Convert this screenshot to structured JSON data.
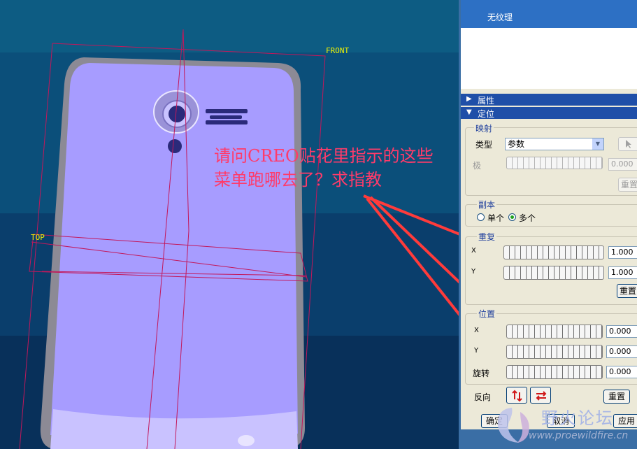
{
  "viewport": {
    "plane_front": "FRONT",
    "plane_top": "TOP",
    "question_line1": "请问CREO贴花里指示的这些",
    "question_line2": "菜单跑哪去了？求指教"
  },
  "panel": {
    "list": {
      "selected_item": "无纹理"
    },
    "sections": {
      "properties": "属性",
      "placement": "定位"
    },
    "mapping": {
      "title": "映射",
      "type_label": "类型",
      "type_value": "参数",
      "pole_label": "极",
      "pole_value": "0.000",
      "reset_label": "重置"
    },
    "copy": {
      "title": "副本",
      "single_label": "单个",
      "multiple_label": "多个",
      "selected": "多个"
    },
    "repeat": {
      "title": "重复",
      "x_label": "X",
      "x_value": "1.000",
      "y_label": "Y",
      "y_value": "1.000",
      "reset_label": "重置"
    },
    "position": {
      "title": "位置",
      "x_label": "X",
      "x_value": "0.000",
      "y_label": "Y",
      "y_value": "0.000",
      "rotate_label": "旋转",
      "rotate_value": "0.000",
      "flip_label": "反向",
      "reset_label": "重置"
    },
    "footer": {
      "ok_label": "确定",
      "cancel_label": "取消",
      "apply_label": "应用"
    }
  },
  "watermark": {
    "title": "野火论坛",
    "url": "www.proewildfire.cn"
  },
  "colors": {
    "phone_face": "#a79cff",
    "arrow": "#ff3b3b",
    "panel_header": "#1f4fa8",
    "list_selection": "#2d70c4",
    "datum_plane": "#c2185b"
  },
  "icons": [
    "dropdown-arrow-icon",
    "cursor-select-icon",
    "flip-vertical-icon",
    "flip-horizontal-icon",
    "annotation-arrow-icon"
  ]
}
